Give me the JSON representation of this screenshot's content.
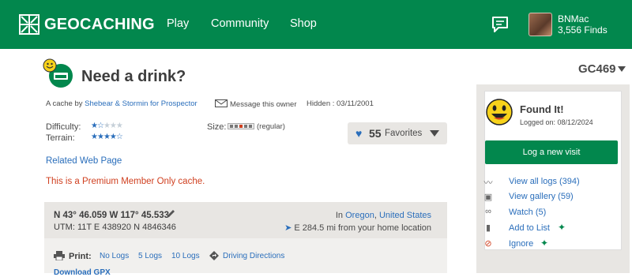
{
  "header": {
    "logo_text": "GEOCACHING",
    "nav": [
      "Play",
      "Community",
      "Shop"
    ],
    "user": {
      "name": "BNMac",
      "finds": "3,556 Finds"
    }
  },
  "cache": {
    "title": "Need a drink?",
    "code": "GC469",
    "by_prefix": "A cache by",
    "owner": "Shebear & Stormin for Prospector",
    "message_owner": "Message this owner",
    "hidden": "Hidden : 03/11/2001",
    "difficulty_label": "Difficulty:",
    "difficulty": 1.5,
    "terrain_label": "Terrain:",
    "terrain": 4.5,
    "size_label": "Size:",
    "size": "(regular)",
    "favorites_count": "55",
    "favorites_label": "Favorites",
    "related": "Related Web Page",
    "premium_notice": "This is a Premium Member Only cache."
  },
  "coordinates": {
    "main": "N 43° 46.059 W 117° 45.533",
    "utm": "UTM: 11T E 438920 N 4846346",
    "in_prefix": "In",
    "state": "Oregon",
    "country": "United States",
    "distance": "E 284.5 mi from your home location"
  },
  "print": {
    "label": "Print:",
    "links": [
      "No Logs",
      "5 Logs",
      "10 Logs"
    ],
    "directions": "Driving Directions",
    "cut_text": "Download GPX"
  },
  "sidebar": {
    "found_title": "Found It!",
    "found_date": "Logged on: 08/12/2024",
    "log_button": "Log a new visit",
    "links": [
      "View all logs (394)",
      "View gallery (59)",
      "Watch (5)",
      "Add to List",
      "Ignore"
    ]
  },
  "colors": {
    "brand_green": "#02874d",
    "link_blue": "#2a6ebb",
    "alert_red": "#d04020"
  }
}
